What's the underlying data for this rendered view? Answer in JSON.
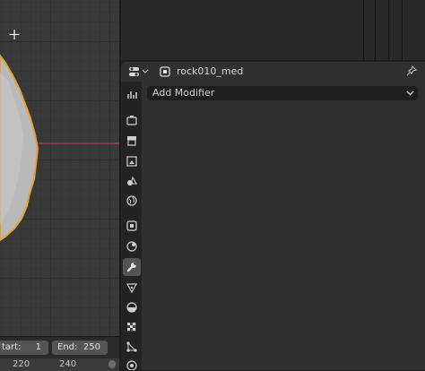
{
  "properties": {
    "object_name": "rock010_med",
    "add_modifier_label": "Add Modifier"
  },
  "timeline": {
    "start_label": "tart:",
    "start_value": "1",
    "end_label": "End:",
    "end_value": "250",
    "ruler_a": "220",
    "ruler_b": "240"
  },
  "tabs": [
    "tool",
    "render",
    "output",
    "view-layer",
    "scene",
    "world",
    "object",
    "physics",
    "modifier",
    "particles",
    "physics-constraint",
    "texture",
    "object-data",
    "visibility"
  ],
  "colors": {
    "selection_outline": "#e8a030",
    "x_axis": "#b8474a"
  }
}
